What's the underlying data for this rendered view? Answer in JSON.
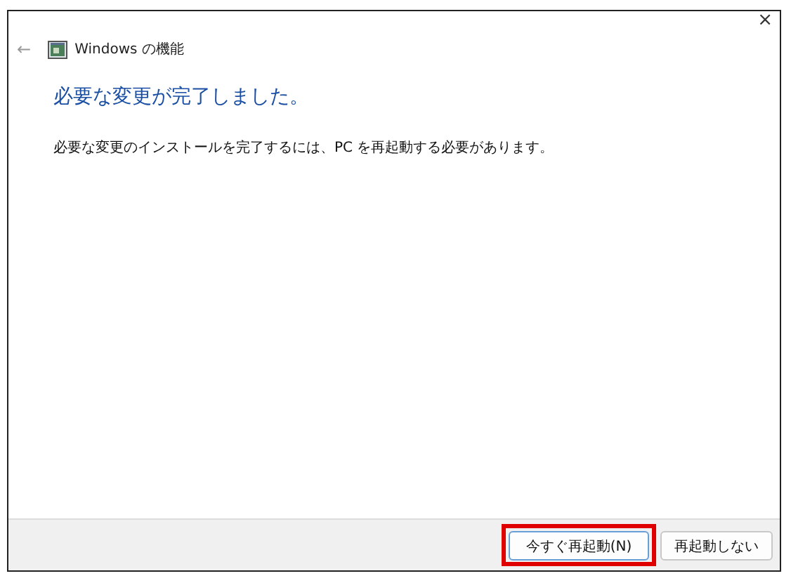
{
  "window": {
    "title": "Windows の機能",
    "close": "×",
    "back": "←"
  },
  "heading": "必要な変更が完了しました。",
  "message": "必要な変更のインストールを完了するには、PC を再起動する必要があります。",
  "buttons": [
    {
      "label": "今すぐ再起動(N)",
      "default": true,
      "highlighted": true
    },
    {
      "label": "再起動しない",
      "default": false,
      "highlighted": false
    }
  ]
}
